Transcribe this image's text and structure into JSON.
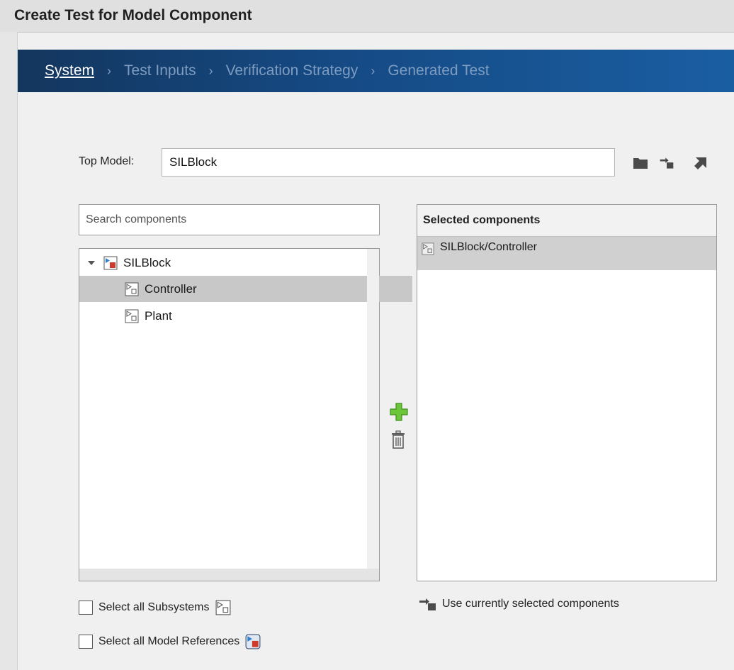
{
  "window": {
    "title": "Create Test for Model Component"
  },
  "wizard": {
    "steps": [
      {
        "label": "System",
        "active": true
      },
      {
        "label": "Test Inputs",
        "active": false
      },
      {
        "label": "Verification Strategy",
        "active": false
      },
      {
        "label": "Generated Test",
        "active": false
      }
    ],
    "separator": "›"
  },
  "top_model": {
    "label": "Top Model:",
    "value": "SILBlock",
    "icons": [
      "folder-icon",
      "use-current-model-icon",
      "open-model-icon"
    ]
  },
  "search": {
    "placeholder": "Search components",
    "value": ""
  },
  "tree": {
    "root": {
      "label": "SILBlock",
      "icon": "model-block-icon",
      "expanded": true
    },
    "children": [
      {
        "label": "Controller",
        "icon": "subsystem-icon",
        "selected": true
      },
      {
        "label": "Plant",
        "icon": "subsystem-icon",
        "selected": false
      }
    ]
  },
  "actions": {
    "add_icon": "plus-icon",
    "remove_icon": "trash-icon"
  },
  "selected_components": {
    "header": "Selected components",
    "items": [
      {
        "label": "SILBlock/Controller",
        "icon": "subsystem-icon"
      }
    ]
  },
  "use_current": {
    "label": "Use currently selected components",
    "icon": "use-current-icon"
  },
  "options": {
    "select_all_subsystems": {
      "label": "Select all Subsystems",
      "checked": false,
      "icon": "subsystem-icon"
    },
    "select_all_model_refs": {
      "label": "Select all Model References",
      "checked": false,
      "icon": "model-reference-icon"
    }
  },
  "colors": {
    "wizard_dark": "#14365e",
    "wizard_light": "#1a5ea2",
    "active_step": "#ffffff",
    "inactive_step": "#7e9cc0",
    "selected_row": "#c8c8c8",
    "add_green": "#5cb82e"
  }
}
